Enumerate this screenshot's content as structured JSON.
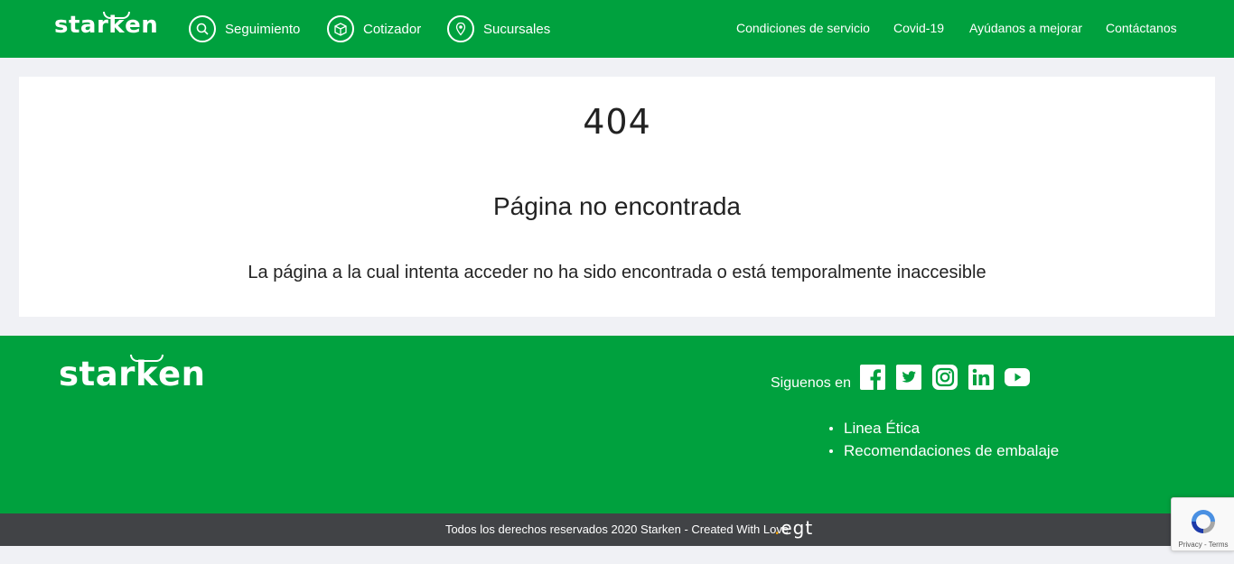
{
  "brand": {
    "name": "starken",
    "name_before_k": "star",
    "name_k": "k",
    "name_after_k": "en"
  },
  "header": {
    "nav": [
      {
        "label": "Seguimiento",
        "icon": "search-icon"
      },
      {
        "label": "Cotizador",
        "icon": "package-icon"
      },
      {
        "label": "Sucursales",
        "icon": "location-pin-icon"
      }
    ],
    "links": [
      "Condiciones de servicio",
      "Covid-19",
      "Ayúdanos a mejorar",
      "Contáctanos"
    ]
  },
  "error": {
    "code": "404",
    "title": "Página no encontrada",
    "message": "La página a la cual intenta acceder no ha sido encontrada o está temporalmente inaccesible"
  },
  "footer": {
    "follow_label": "Siguenos en",
    "social": [
      "facebook-icon",
      "twitter-icon",
      "instagram-icon",
      "linkedin-icon",
      "youtube-icon"
    ],
    "links": [
      "Linea Ética",
      "Recomendaciones de embalaje"
    ],
    "copyright": "Todos los derechos reservados 2020 Starken - Created With Love",
    "credit_logo": "egt"
  },
  "recaptcha": {
    "text": "Privacy - Terms"
  },
  "colors": {
    "brand_green": "#00a13e",
    "dark_bar": "#414346",
    "page_bg": "#f0f1f5"
  }
}
